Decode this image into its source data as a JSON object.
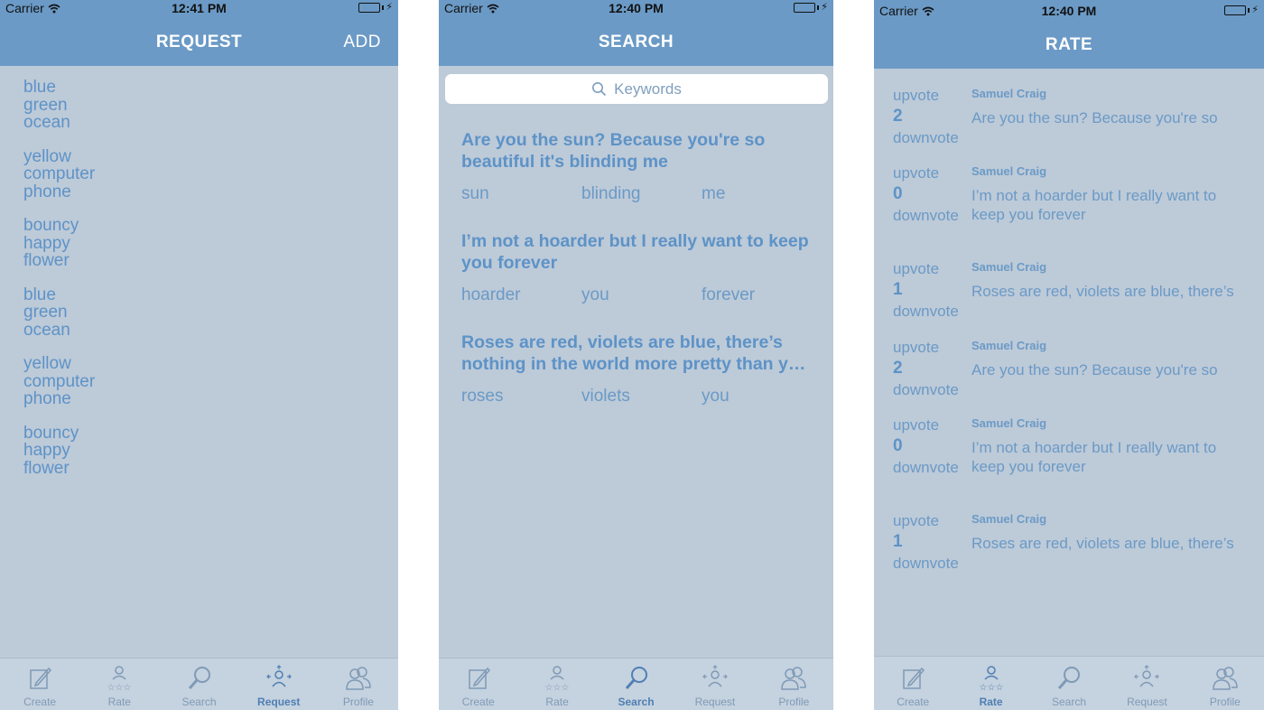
{
  "tabs": [
    {
      "label": "Create",
      "icon": "create-icon"
    },
    {
      "label": "Rate",
      "icon": "rate-icon"
    },
    {
      "label": "Search",
      "icon": "search-icon"
    },
    {
      "label": "Request",
      "icon": "request-icon"
    },
    {
      "label": "Profile",
      "icon": "profile-icon"
    }
  ],
  "screens": {
    "request": {
      "status": {
        "carrier": "Carrier",
        "time": "12:41 PM"
      },
      "title": "REQUEST",
      "add_label": "ADD",
      "active_tab": "Request",
      "groups": [
        [
          "blue",
          "green",
          "ocean"
        ],
        [
          "yellow",
          "computer",
          "phone"
        ],
        [
          "bouncy",
          "happy",
          "flower"
        ],
        [
          "blue",
          "green",
          "ocean"
        ],
        [
          "yellow",
          "computer",
          "phone"
        ],
        [
          "bouncy",
          "happy",
          "flower"
        ]
      ]
    },
    "search": {
      "status": {
        "carrier": "Carrier",
        "time": "12:40 PM"
      },
      "title": "SEARCH",
      "placeholder": "Keywords",
      "active_tab": "Search",
      "results": [
        {
          "quote": "Are you the sun? Because you're so beautiful it's blinding me",
          "keywords": [
            "sun",
            "blinding",
            "me"
          ]
        },
        {
          "quote": "I’m not a hoarder but I really want to keep you forever",
          "keywords": [
            "hoarder",
            "you",
            "forever"
          ]
        },
        {
          "quote": "Roses are red, violets are blue, there’s nothing in the world more pretty than y…",
          "keywords": [
            "roses",
            "violets",
            "you"
          ]
        }
      ]
    },
    "rate": {
      "status": {
        "carrier": "Carrier",
        "time": "12:40 PM"
      },
      "title": "RATE",
      "active_tab": "Rate",
      "upvote_label": "upvote",
      "downvote_label": "downvote",
      "items": [
        {
          "author": "Samuel Craig",
          "score": "2",
          "text": "Are you the sun? Because you're so"
        },
        {
          "author": "Samuel Craig",
          "score": "0",
          "text": "I’m not a hoarder but I really want to keep you forever"
        },
        {
          "author": "Samuel Craig",
          "score": "1",
          "text": "Roses are red, violets are blue, there’s"
        },
        {
          "author": "Samuel Craig",
          "score": "2",
          "text": "Are you the sun? Because you're so"
        },
        {
          "author": "Samuel Craig",
          "score": "0",
          "text": "I’m not a hoarder but I really want to keep you forever"
        },
        {
          "author": "Samuel Craig",
          "score": "1",
          "text": "Roses are red, violets are blue, there’s"
        }
      ]
    }
  }
}
